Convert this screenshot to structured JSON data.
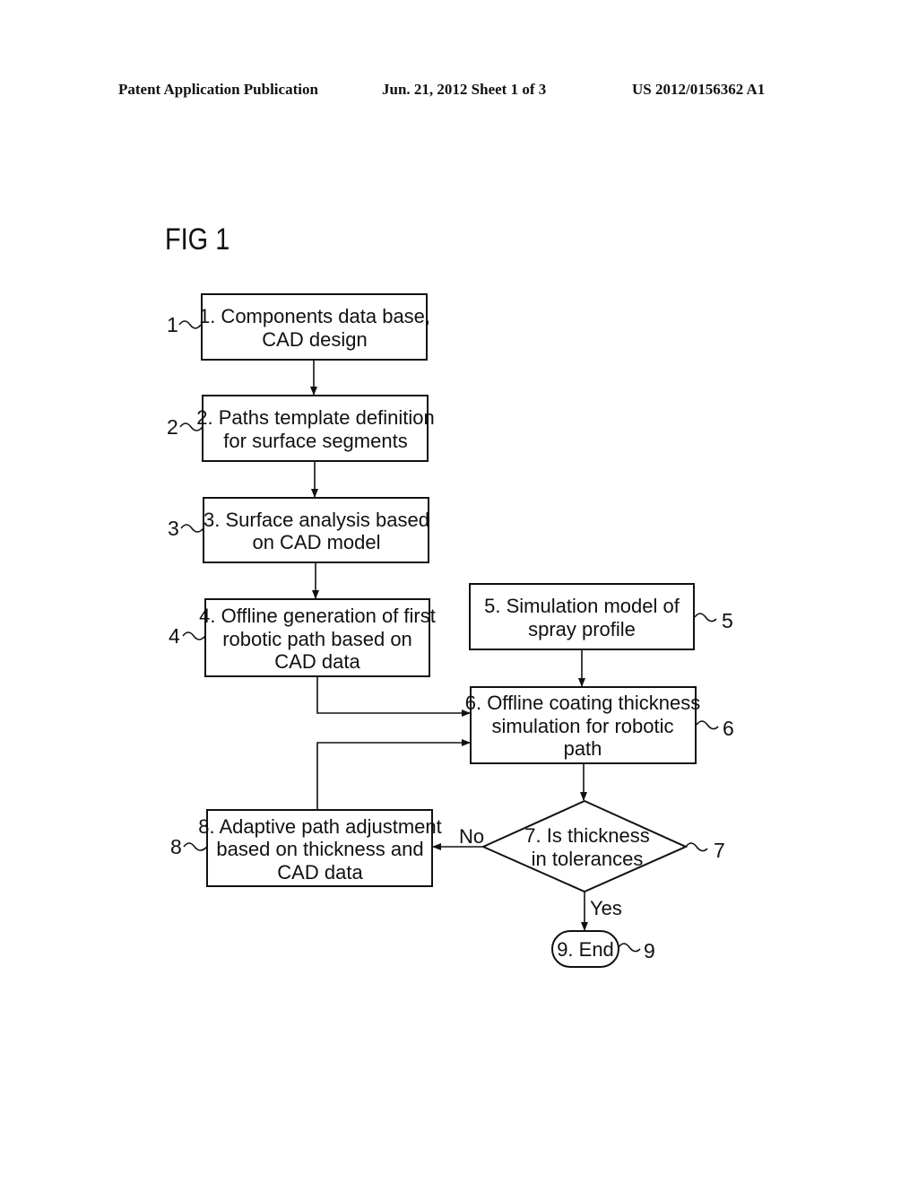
{
  "header": {
    "publication": "Patent Application Publication",
    "date_sheet": "Jun. 21, 2012  Sheet 1 of 3",
    "number": "US 2012/0156362 A1"
  },
  "figure": {
    "title": "FIG 1",
    "nodes": [
      {
        "id": "1",
        "ref": "1",
        "shape": "rect",
        "lines": [
          "1. Components data base,",
          "CAD design"
        ]
      },
      {
        "id": "2",
        "ref": "2",
        "shape": "rect",
        "lines": [
          "2. Paths template definition",
          "for surface segments"
        ]
      },
      {
        "id": "3",
        "ref": "3",
        "shape": "rect",
        "lines": [
          "3. Surface analysis based",
          "on CAD model"
        ]
      },
      {
        "id": "4",
        "ref": "4",
        "shape": "rect",
        "lines": [
          "4. Offline generation of first",
          "robotic path based on",
          "CAD data"
        ]
      },
      {
        "id": "5",
        "ref": "5",
        "shape": "rect",
        "lines": [
          "5. Simulation model of",
          "spray profile"
        ]
      },
      {
        "id": "6",
        "ref": "6",
        "shape": "rect",
        "lines": [
          "6. Offline coating thickness",
          "simulation for robotic",
          "path"
        ]
      },
      {
        "id": "7",
        "ref": "7",
        "shape": "diamond",
        "lines": [
          "7. Is thickness",
          "in tolerances"
        ]
      },
      {
        "id": "8",
        "ref": "8",
        "shape": "rect",
        "lines": [
          "8. Adaptive path adjustment",
          "based on thickness and",
          "CAD data"
        ]
      },
      {
        "id": "9",
        "ref": "9",
        "shape": "terminal",
        "lines": [
          "9. End"
        ]
      }
    ],
    "edges": [
      {
        "from": "1",
        "to": "2",
        "label": ""
      },
      {
        "from": "2",
        "to": "3",
        "label": ""
      },
      {
        "from": "3",
        "to": "4",
        "label": ""
      },
      {
        "from": "4",
        "to": "6",
        "label": ""
      },
      {
        "from": "5",
        "to": "6",
        "label": ""
      },
      {
        "from": "6",
        "to": "7",
        "label": ""
      },
      {
        "from": "7",
        "to": "8",
        "label": "No"
      },
      {
        "from": "8",
        "to": "6",
        "label": ""
      },
      {
        "from": "7",
        "to": "9",
        "label": "Yes"
      }
    ]
  }
}
